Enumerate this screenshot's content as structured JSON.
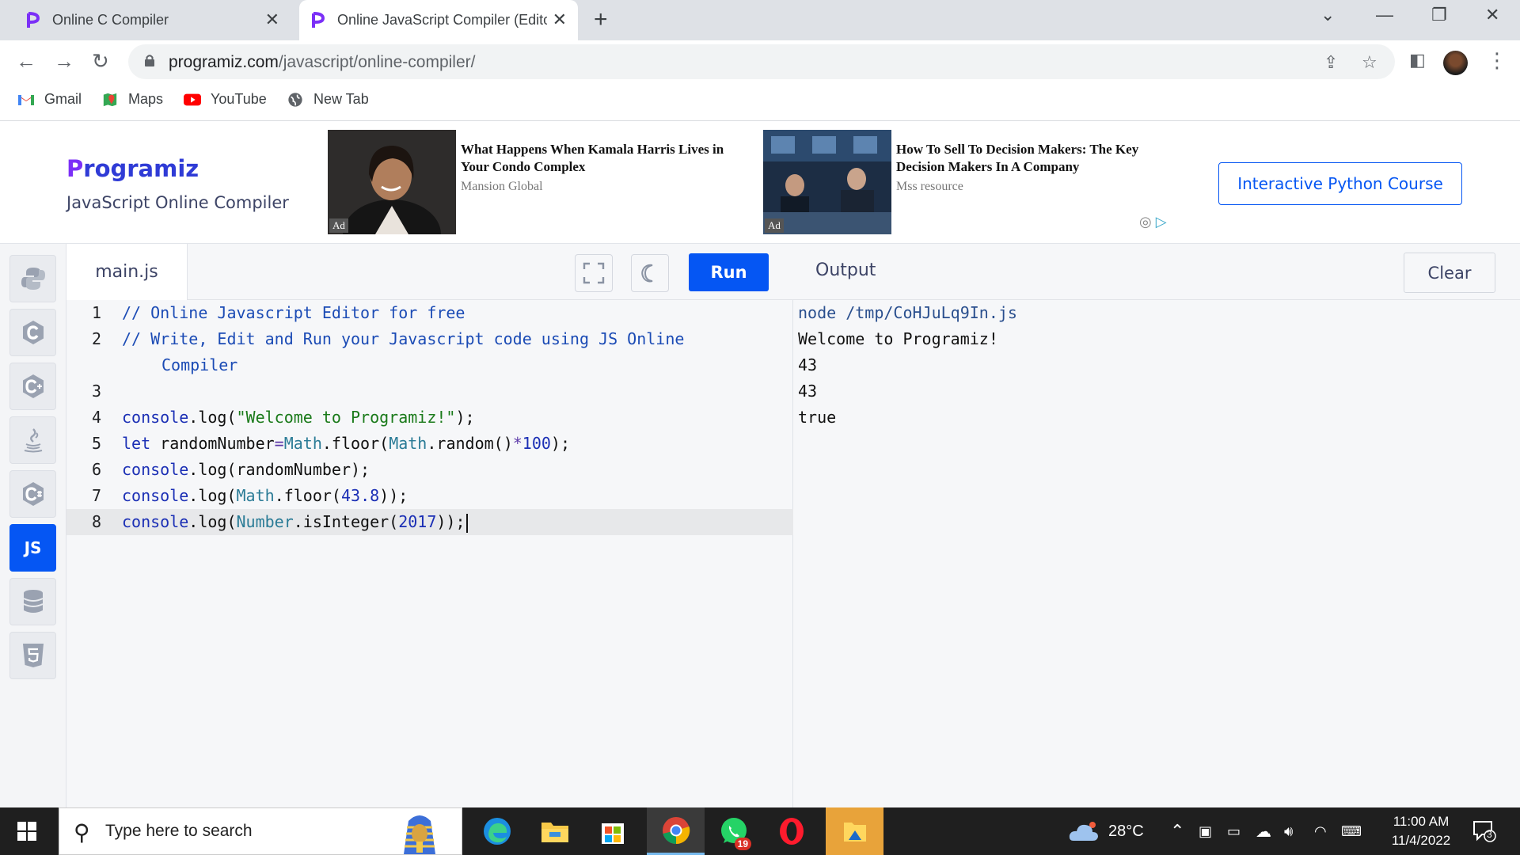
{
  "browser": {
    "tabs": [
      {
        "title": "Online C Compiler",
        "active": false
      },
      {
        "title": "Online JavaScript Compiler (Editor)",
        "active": true
      }
    ],
    "url_host": "programiz.com",
    "url_path": "/javascript/online-compiler/",
    "bookmarks": [
      {
        "label": "Gmail",
        "icon": "gmail-icon"
      },
      {
        "label": "Maps",
        "icon": "maps-icon"
      },
      {
        "label": "YouTube",
        "icon": "youtube-icon"
      },
      {
        "label": "New Tab",
        "icon": "globe-icon"
      }
    ]
  },
  "site": {
    "logo": "rogramiz",
    "logo_p": "P",
    "subtitle": "JavaScript Online Compiler",
    "ads": [
      {
        "title": "What Happens When Kamala Harris Lives in Your Condo Complex",
        "source": "Mansion Global",
        "badge": "Ad"
      },
      {
        "title": "How To Sell To Decision Makers: The Key Decision Makers In A Company",
        "source": "Mss resource",
        "badge": "Ad"
      }
    ],
    "cta": "Interactive Python Course"
  },
  "languages": [
    {
      "name": "python-icon",
      "label": ""
    },
    {
      "name": "c-icon",
      "label": ""
    },
    {
      "name": "cpp-icon",
      "label": ""
    },
    {
      "name": "java-icon",
      "label": ""
    },
    {
      "name": "csharp-icon",
      "label": ""
    },
    {
      "name": "js-icon",
      "label": "JS",
      "active": true
    },
    {
      "name": "sql-icon",
      "label": ""
    },
    {
      "name": "html-icon",
      "label": ""
    }
  ],
  "editor": {
    "file_name": "main.js",
    "run_label": "Run",
    "lines": [
      "1",
      "2",
      "",
      "3",
      "4",
      "5",
      "6",
      "7",
      "8"
    ]
  },
  "output": {
    "title": "Output",
    "clear_label": "Clear",
    "lines": [
      "node /tmp/CoHJuLq9In.js",
      "Welcome to Programiz!",
      "43",
      "43",
      "true"
    ]
  },
  "taskbar": {
    "search_placeholder": "Type here to search",
    "whatsapp_badge": "19",
    "temperature": "28°C",
    "time": "11:00 AM",
    "date": "11/4/2022",
    "notifications": "3"
  }
}
